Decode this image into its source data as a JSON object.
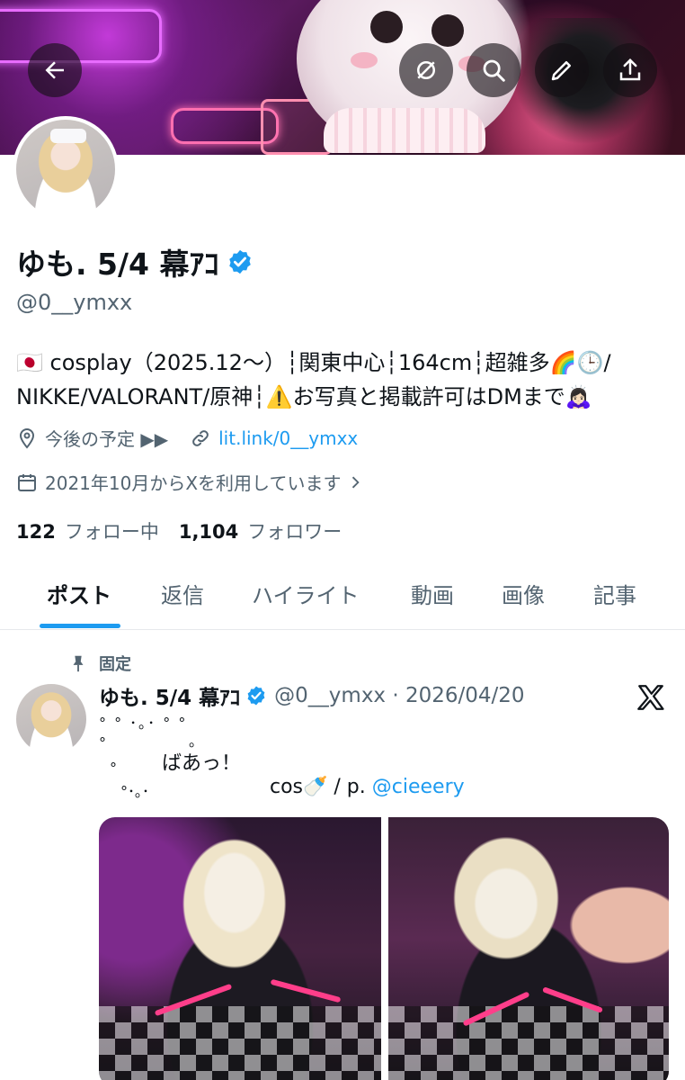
{
  "profile": {
    "display_name": "ゆも. 5/4 幕ｱｺ",
    "handle": "@0__ymxx",
    "bio_line1": "🇯🇵 cosplay（2025.12～）┆関東中心┆164cm┆超雑多🌈🕒/",
    "bio_line2": "NIKKE/VALORANT/原神┆⚠️お写真と掲載許可はDMまで🙇🏻‍♀️",
    "location": "今後の予定 ▶▶",
    "link": "lit.link/0__ymxx",
    "joined": "2021年10月からXを利用しています",
    "following_count": "122",
    "following_label": "フォロー中",
    "followers_count": "1,104",
    "followers_label": "フォロワー"
  },
  "header_buttons": {
    "back": "back-arrow-icon",
    "grok": "grok-icon",
    "search": "search-icon",
    "edit": "pencil-icon",
    "share": "share-icon"
  },
  "tabs": [
    {
      "label": "ポスト",
      "active": true
    },
    {
      "label": "返信",
      "active": false
    },
    {
      "label": "ハイライト",
      "active": false
    },
    {
      "label": "動画",
      "active": false
    },
    {
      "label": "画像",
      "active": false
    },
    {
      "label": "記事",
      "active": false
    }
  ],
  "post": {
    "pinned_label": "固定",
    "author_name": "ゆも. 5/4 幕ｱｺ",
    "author_handle_date": "@0__ymxx · 2026/04/20",
    "text_line1": "° ° ･｡･ ° °",
    "text_line2": "°",
    "text_line2b": "。",
    "text_line3": "ばあっ！",
    "text_line4": "°",
    "text_line5": "°･｡･",
    "text_cos": "cos🍼 / p. ",
    "mention": "@cieeery"
  },
  "colors": {
    "accent": "#1d9bf0",
    "text_primary": "#0f1419",
    "text_secondary": "#536471"
  }
}
